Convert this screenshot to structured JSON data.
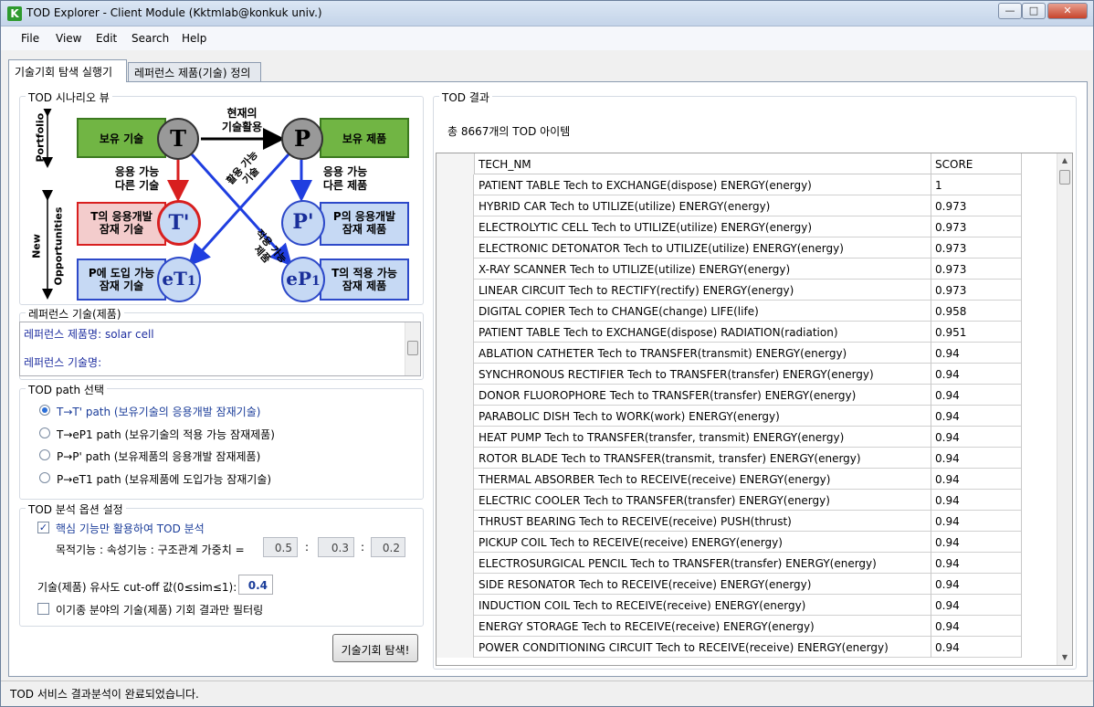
{
  "window": {
    "title": "TOD Explorer - Client Module (Kktmlab@konkuk univ.)",
    "app_icon": "K",
    "btn_min": "—",
    "btn_max": "□",
    "btn_close": "✕"
  },
  "menu": [
    "File",
    "View",
    "Edit",
    "Search",
    "Help"
  ],
  "tabs": [
    "기술기회 탐색 실행기",
    "레퍼런스 제품(기술) 정의"
  ],
  "scenario": {
    "group_title": "TOD 시나리오 뷰",
    "side_portfolio": "Portfolio",
    "side_new1": "New",
    "side_new2": "Opportunities",
    "box_owned_tech": "보유 기술",
    "box_owned_product": "보유 제품",
    "box_t_prime_1": "T의 응용개발",
    "box_t_prime_2": "잠재 기술",
    "box_p_prime_1": "P의 응용개발",
    "box_p_prime_2": "잠재 제품",
    "box_et1_1": "P에 도입 가능",
    "box_et1_2": "잠재 기술",
    "box_ep1_1": "T의 적용 가능",
    "box_ep1_2": "잠재 제품",
    "circle_T": "T",
    "circle_P": "P",
    "circle_Tp": "T'",
    "circle_Pp": "P'",
    "circle_eT1": "eT",
    "circle_eT1_sub": "1",
    "circle_eP1": "eP",
    "circle_eP1_sub": "1",
    "label_current_1": "현재의",
    "label_current_2": "기술활용",
    "label_left_1": "응용 가능",
    "label_left_2": "다른 기술",
    "label_right_1": "응용 가능",
    "label_right_2": "다른 제품",
    "label_diag_up_1": "활용 가능",
    "label_diag_up_2": "기술",
    "label_diag_down_1": "적용 가능",
    "label_diag_down_2": "제품"
  },
  "reference": {
    "group_title": "레퍼런스 기술(제품)",
    "product_line": "레퍼런스 제품명: solar cell",
    "tech_line": "레퍼런스 기술명:"
  },
  "path": {
    "group_title": "TOD path 선택",
    "options": [
      {
        "label": "T→T' path (보유기술의 응용개발 잠재기술)",
        "checked": true
      },
      {
        "label": "T→eP1 path (보유기술의 적용 가능 잠재제품)",
        "checked": false
      },
      {
        "label": "P→P' path (보유제품의 응용개발 잠재제품)",
        "checked": false
      },
      {
        "label": "P→eT1 path (보유제품에 도입가능 잠재기술)",
        "checked": false
      }
    ]
  },
  "options": {
    "group_title": "TOD 분석 옵션 설정",
    "core_check_label": "핵심 기능만 활용하여 TOD 분석",
    "core_check_mark": "✓",
    "weights_label": "목적기능 : 속성기능 : 구조관계 가중치 =",
    "weight1": "0.5",
    "weight2": "0.3",
    "weight3": "0.2",
    "colon": ":",
    "cutoff_label": "기술(제품) 유사도 cut-off 값(0≤sim≤1):",
    "cutoff_value": "0.4",
    "filter_label": "이기종 분야의 기술(제품) 기회 결과만 필터링",
    "search_button": "기술기회 탐색!"
  },
  "results": {
    "group_title": "TOD 결과",
    "count_text": "총 8667개의 TOD 아이템",
    "columns": [
      "TECH_NM",
      "SCORE"
    ],
    "rows": [
      [
        "PATIENT TABLE Tech to EXCHANGE(dispose) ENERGY(energy)",
        "1"
      ],
      [
        "HYBRID CAR Tech to UTILIZE(utilize) ENERGY(energy)",
        "0.973"
      ],
      [
        "ELECTROLYTIC CELL Tech to UTILIZE(utilize) ENERGY(energy)",
        "0.973"
      ],
      [
        "ELECTRONIC DETONATOR Tech to UTILIZE(utilize) ENERGY(energy)",
        "0.973"
      ],
      [
        "X-RAY SCANNER Tech to UTILIZE(utilize) ENERGY(energy)",
        "0.973"
      ],
      [
        "LINEAR CIRCUIT Tech to RECTIFY(rectify) ENERGY(energy)",
        "0.973"
      ],
      [
        "DIGITAL COPIER Tech to CHANGE(change) LIFE(life)",
        "0.958"
      ],
      [
        "PATIENT TABLE Tech to EXCHANGE(dispose) RADIATION(radiation)",
        "0.951"
      ],
      [
        "ABLATION CATHETER Tech to TRANSFER(transmit) ENERGY(energy)",
        "0.94"
      ],
      [
        "SYNCHRONOUS RECTIFIER Tech to TRANSFER(transfer) ENERGY(energy)",
        "0.94"
      ],
      [
        "DONOR FLUOROPHORE Tech to TRANSFER(transfer) ENERGY(energy)",
        "0.94"
      ],
      [
        "PARABOLIC DISH Tech to WORK(work) ENERGY(energy)",
        "0.94"
      ],
      [
        "HEAT PUMP Tech to TRANSFER(transfer, transmit) ENERGY(energy)",
        "0.94"
      ],
      [
        "ROTOR BLADE Tech to TRANSFER(transmit, transfer) ENERGY(energy)",
        "0.94"
      ],
      [
        "THERMAL ABSORBER Tech to RECEIVE(receive) ENERGY(energy)",
        "0.94"
      ],
      [
        "ELECTRIC COOLER Tech to TRANSFER(transfer) ENERGY(energy)",
        "0.94"
      ],
      [
        "THRUST BEARING Tech to RECEIVE(receive) PUSH(thrust)",
        "0.94"
      ],
      [
        "PICKUP COIL Tech to RECEIVE(receive) ENERGY(energy)",
        "0.94"
      ],
      [
        "ELECTROSURGICAL PENCIL Tech to TRANSFER(transfer) ENERGY(energy)",
        "0.94"
      ],
      [
        "SIDE RESONATOR Tech to RECEIVE(receive) ENERGY(energy)",
        "0.94"
      ],
      [
        "INDUCTION COIL Tech to RECEIVE(receive) ENERGY(energy)",
        "0.94"
      ],
      [
        "ENERGY STORAGE Tech to RECEIVE(receive) ENERGY(energy)",
        "0.94"
      ],
      [
        "POWER CONDITIONING CIRCUIT Tech to RECEIVE(receive) ENERGY(energy)",
        "0.94"
      ]
    ]
  },
  "status": "TOD 서비스 결과분석이 완료되었습니다."
}
